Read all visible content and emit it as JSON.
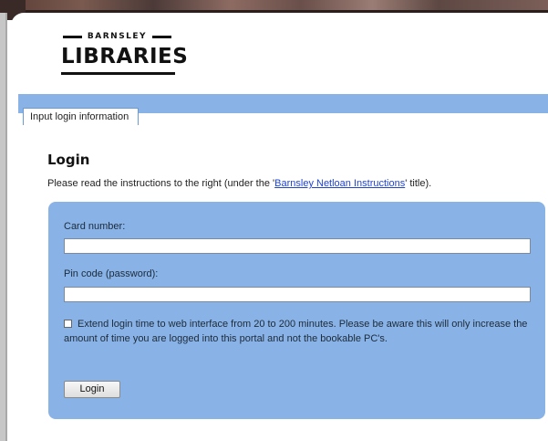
{
  "logo": {
    "top_text": "BARNSLEY",
    "main_text": "LIBRARIES"
  },
  "tabs": [
    {
      "label": "Input login information"
    }
  ],
  "login": {
    "heading": "Login",
    "intro_before": "Please read the instructions to the right (under the '",
    "intro_link": "Barnsley Netloan Instructions",
    "intro_after": "' title)."
  },
  "form": {
    "card_label": "Card number:",
    "card_value": "",
    "pin_label": "Pin code (password):",
    "pin_value": "",
    "extend_label": "Extend login time to web interface from 20 to 200 minutes. Please be aware this will only increase the amount of time you are logged into this portal and not the bookable PC's.",
    "extend_checked": false,
    "submit_label": "Login"
  },
  "colors": {
    "panel": "#89b3e6",
    "tabbar": "#89b3e6",
    "link": "#2244cc"
  }
}
